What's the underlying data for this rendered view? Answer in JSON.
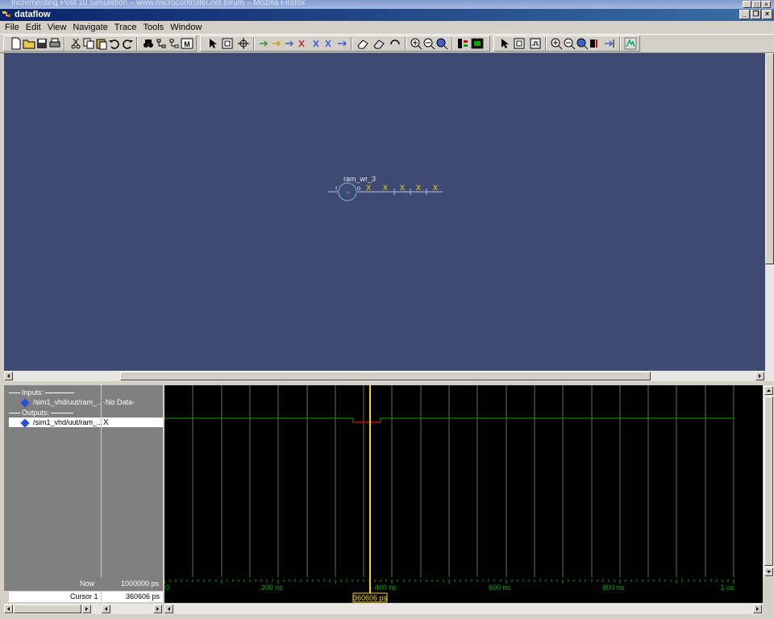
{
  "browser_title": "Incrementing Post 10 Simulation – www.microcontroller.net forum – Mozilla Firefox",
  "window": {
    "title": "dataflow"
  },
  "menu": [
    "File",
    "Edit",
    "View",
    "Navigate",
    "Trace",
    "Tools",
    "Window"
  ],
  "dataflow": {
    "node_label": "ram_wr_3",
    "input_pin": "i",
    "output_pin": "o",
    "x_marks": [
      "X",
      "X",
      "X",
      "X",
      "X"
    ]
  },
  "wave": {
    "inputs_label": "Inputs:",
    "outputs_label": "Outputs:",
    "signals": [
      {
        "name": "/sim1_vhd/uut/ram_...",
        "value": "-No Data-"
      },
      {
        "name": "/sim1_vhd/uut/ram_...",
        "value": "X"
      }
    ],
    "now_label": "Now",
    "now_value": "1000000 ps",
    "cursor_label": "Cursor 1",
    "cursor_value": "360606 ps",
    "cursor_tag": "360606 ps",
    "time_ticks": [
      "0",
      "200 ns",
      "400 ns",
      "600 ns",
      "800 ns",
      "1 us"
    ],
    "cursor_fraction": 0.3606
  },
  "colors": {
    "canvas": "#3f4a72",
    "wave_green": "#00b000",
    "wave_red": "#d00000",
    "cursor": "#ffd700"
  }
}
